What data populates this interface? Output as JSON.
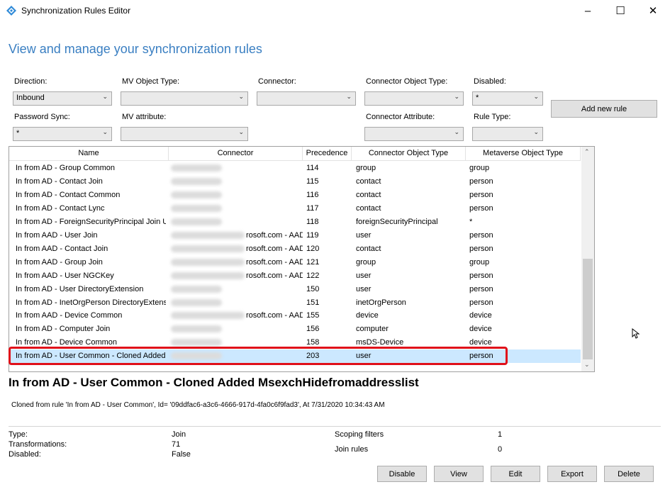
{
  "window": {
    "title": "Synchronization Rules Editor"
  },
  "heading": "View and manage your synchronization rules",
  "filters": {
    "direction": {
      "label": "Direction:",
      "value": "Inbound"
    },
    "mv_object_type": {
      "label": "MV Object Type:",
      "value": ""
    },
    "connector": {
      "label": "Connector:",
      "value": ""
    },
    "connector_object_type": {
      "label": "Connector Object Type:",
      "value": ""
    },
    "disabled": {
      "label": "Disabled:",
      "value": "*"
    },
    "password_sync": {
      "label": "Password Sync:",
      "value": "*"
    },
    "mv_attribute": {
      "label": "MV attribute:",
      "value": ""
    },
    "connector_attribute": {
      "label": "Connector Attribute:",
      "value": ""
    },
    "rule_type": {
      "label": "Rule Type:",
      "value": ""
    }
  },
  "add_new_rule": "Add new rule",
  "grid": {
    "columns": [
      "Name",
      "Connector",
      "Precedence",
      "Connector Object Type",
      "Metaverse Object Type"
    ],
    "rows": [
      {
        "name": "In from AD - Group Common",
        "connector": "",
        "precedence": "114",
        "cot": "group",
        "mot": "group"
      },
      {
        "name": "In from AD - Contact Join",
        "connector": "",
        "precedence": "115",
        "cot": "contact",
        "mot": "person"
      },
      {
        "name": "In from AD - Contact Common",
        "connector": "",
        "precedence": "116",
        "cot": "contact",
        "mot": "person"
      },
      {
        "name": "In from AD - Contact Lync",
        "connector": "",
        "precedence": "117",
        "cot": "contact",
        "mot": "person"
      },
      {
        "name": "In from AD - ForeignSecurityPrincipal Join Us",
        "connector": "",
        "precedence": "118",
        "cot": "foreignSecurityPrincipal",
        "mot": "*"
      },
      {
        "name": "In from AAD - User Join",
        "connector": "rosoft.com - AAD",
        "precedence": "119",
        "cot": "user",
        "mot": "person"
      },
      {
        "name": "In from AAD - Contact Join",
        "connector": "rosoft.com - AAD",
        "precedence": "120",
        "cot": "contact",
        "mot": "person"
      },
      {
        "name": "In from AAD - Group Join",
        "connector": "rosoft.com - AAD",
        "precedence": "121",
        "cot": "group",
        "mot": "group"
      },
      {
        "name": "In from AAD - User NGCKey",
        "connector": "rosoft.com - AAD",
        "precedence": "122",
        "cot": "user",
        "mot": "person"
      },
      {
        "name": "In from AD - User DirectoryExtension",
        "connector": "",
        "precedence": "150",
        "cot": "user",
        "mot": "person"
      },
      {
        "name": "In from AD - InetOrgPerson DirectoryExtensic",
        "connector": "",
        "precedence": "151",
        "cot": "inetOrgPerson",
        "mot": "person"
      },
      {
        "name": "In from AAD - Device Common",
        "connector": "rosoft.com - AAD",
        "precedence": "155",
        "cot": "device",
        "mot": "device"
      },
      {
        "name": "In from AD - Computer Join",
        "connector": "",
        "precedence": "156",
        "cot": "computer",
        "mot": "device"
      },
      {
        "name": "In from AD - Device Common",
        "connector": "",
        "precedence": "158",
        "cot": "msDS-Device",
        "mot": "device"
      },
      {
        "name": "In from AD - User Common - Cloned Added I",
        "connector": "",
        "precedence": "203",
        "cot": "user",
        "mot": "person",
        "selected": true
      }
    ]
  },
  "details": {
    "title": "In from AD - User Common - Cloned Added MsexchHidefromaddresslist",
    "subtitle": "Cloned from rule 'In from AD - User Common', Id= '09ddfac6-a3c6-4666-917d-4fa0c6f9fad3', At 7/31/2020 10:34:43 AM",
    "type_label": "Type:",
    "type_value": "Join",
    "transformations_label": "Transformations:",
    "transformations_value": "71",
    "disabled_label": "Disabled:",
    "disabled_value": "False",
    "scoping_label": "Scoping filters",
    "scoping_value": "1",
    "join_label": "Join rules",
    "join_value": "0"
  },
  "actions": [
    "Disable",
    "View",
    "Edit",
    "Export",
    "Delete"
  ],
  "colors": {
    "heading": "#3a7fc2",
    "selection": "#cce8ff",
    "highlight_box": "#e0101a"
  }
}
